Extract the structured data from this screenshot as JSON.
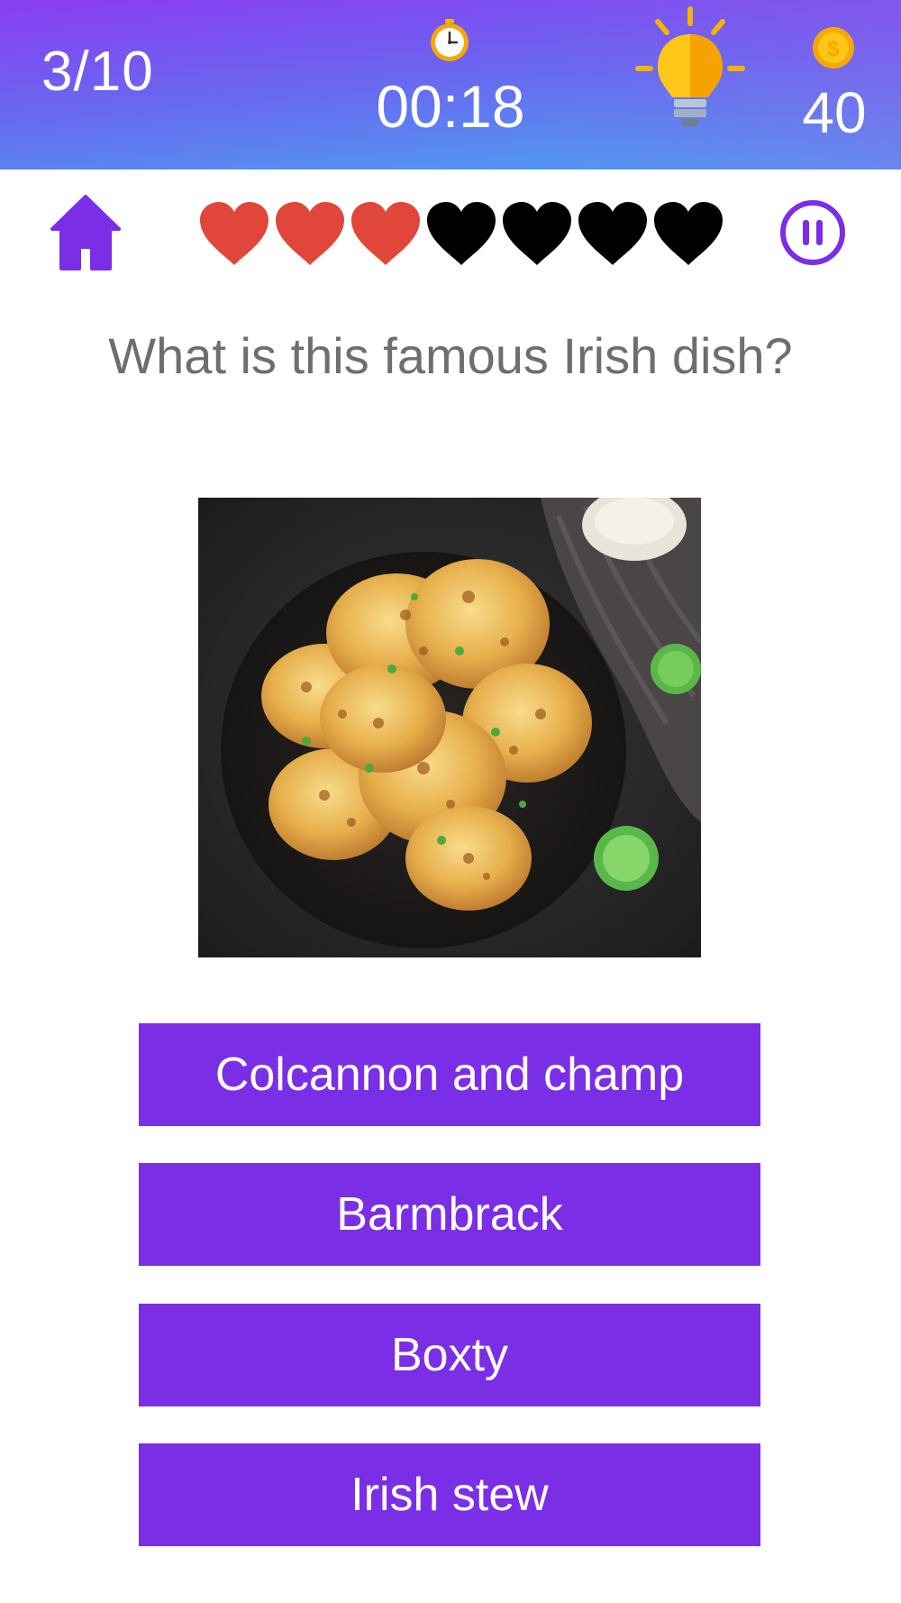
{
  "header": {
    "progress": "3/10",
    "timer": "00:18",
    "coins": "40",
    "icons": [
      "clock-icon",
      "lightbulb-hint-icon",
      "dollar-coin-icon"
    ]
  },
  "controls": {
    "icons": [
      "home-icon",
      "pause-icon"
    ]
  },
  "lives": {
    "remaining": 3,
    "total": 7,
    "filled_color": "#e0473a",
    "empty_color": "#000000"
  },
  "question": {
    "text": "What is this famous Irish dish?"
  },
  "answers": [
    {
      "label": "Colcannon and champ"
    },
    {
      "label": "Barmbrack"
    },
    {
      "label": "Boxty"
    },
    {
      "label": "Irish stew"
    }
  ],
  "colors": {
    "accent": "#7a2ee6",
    "question_text": "#6e6e6e"
  }
}
